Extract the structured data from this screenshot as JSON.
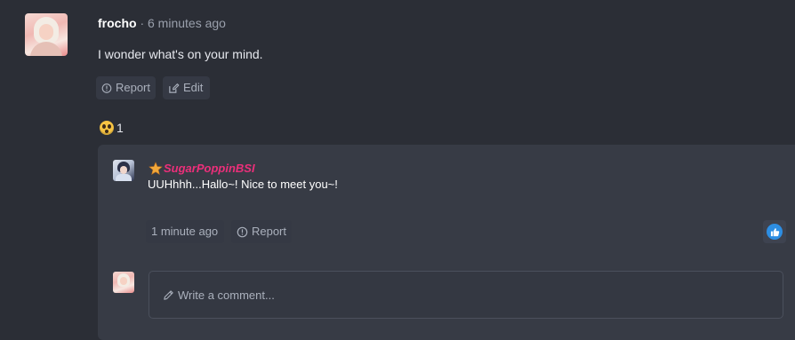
{
  "post": {
    "author": "frocho",
    "time": " · 6 minutes ago",
    "body": "I wonder what's on your mind.",
    "actions": {
      "report_label": "Report",
      "edit_label": "Edit"
    },
    "reaction": {
      "emoji": "flushed-face-icon",
      "count": "1"
    }
  },
  "reply": {
    "author": "SugarPoppinBSI",
    "author_color": "#ec2f7a",
    "body": "UUHhhh...Hallo~! Nice to meet you~!",
    "time_label": "1 minute ago",
    "report_label": "Report",
    "like_icon": "thumbs-up-icon",
    "like_color": "#2d8ee3"
  },
  "composer": {
    "placeholder": "Write a comment...",
    "icon": "pencil-icon"
  },
  "colors": {
    "background": "#2b2e36",
    "panel": "#373b45",
    "button_bg": "#353944",
    "muted_text": "#aab0bc"
  }
}
